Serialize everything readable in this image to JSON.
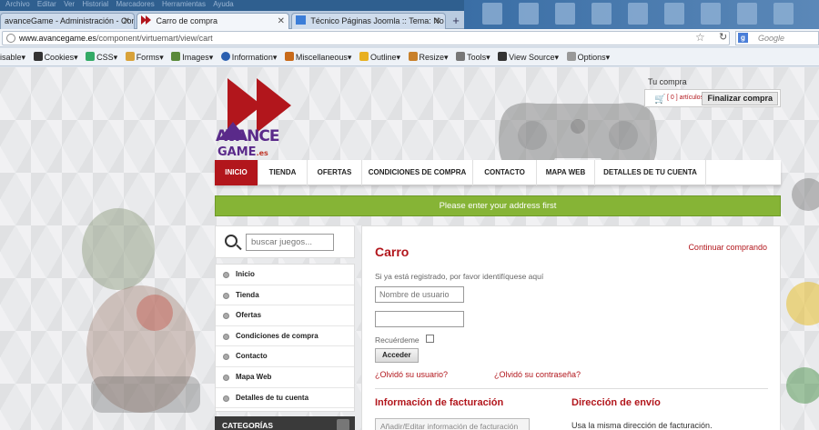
{
  "browser": {
    "menu": [
      "Archivo",
      "Editar",
      "Ver",
      "Historial",
      "Marcadores",
      "Herramientas",
      "Ayuda"
    ],
    "tabs": [
      {
        "label": "avanceGame - Administración - Con...",
        "active": false
      },
      {
        "label": "Carro de compra",
        "active": true
      },
      {
        "label": "Técnico Páginas Joomla :: Tema: No ...",
        "active": false
      }
    ],
    "new_tab": "+",
    "url_domain": "www.avancegame.es",
    "url_path": "/component/virtuemart/view/cart",
    "search_placeholder": "Google"
  },
  "devbar": {
    "items": [
      "isable",
      "Cookies",
      "CSS",
      "Forms",
      "Images",
      "Information",
      "Miscellaneous",
      "Outline",
      "Resize",
      "Tools",
      "View Source",
      "Options"
    ]
  },
  "site": {
    "logo_line1": "AVANCE",
    "logo_line2": "GAME",
    "logo_suffix": ".es",
    "cart_title": "Tu compra",
    "cart_count": "[ 0 ] artículos",
    "cart_checkout": "Finalizar compra",
    "nav": [
      "INICIO",
      "TIENDA",
      "OFERTAS",
      "CONDICIONES DE COMPRA",
      "CONTACTO",
      "MAPA WEB",
      "DETALLES DE TU CUENTA"
    ],
    "alert": "Please enter your address first",
    "search_placeholder": "buscar juegos...",
    "side_menu": [
      "Inicio",
      "Tienda",
      "Ofertas",
      "Condiciones de compra",
      "Contacto",
      "Mapa Web",
      "Detalles de tu cuenta"
    ],
    "categories_title": "CATEGORÍAS"
  },
  "cart": {
    "title": "Carro",
    "continue": "Continuar comprando",
    "login_hint": "Si ya está registrado, por favor identifíquese aquí",
    "username_placeholder": "Nombre de usuario",
    "password_value": "",
    "remember": "Recuérdeme",
    "login_button": "Acceder",
    "forgot_user": "¿Olvidó su usuario?",
    "forgot_pass": "¿Olvidó su contraseña?",
    "billing_title": "Información de facturación",
    "shipping_title": "Dirección de envío",
    "billing_button": "Añadir/Editar información de facturación",
    "same_address": "Usa la misma dirección de facturación."
  }
}
